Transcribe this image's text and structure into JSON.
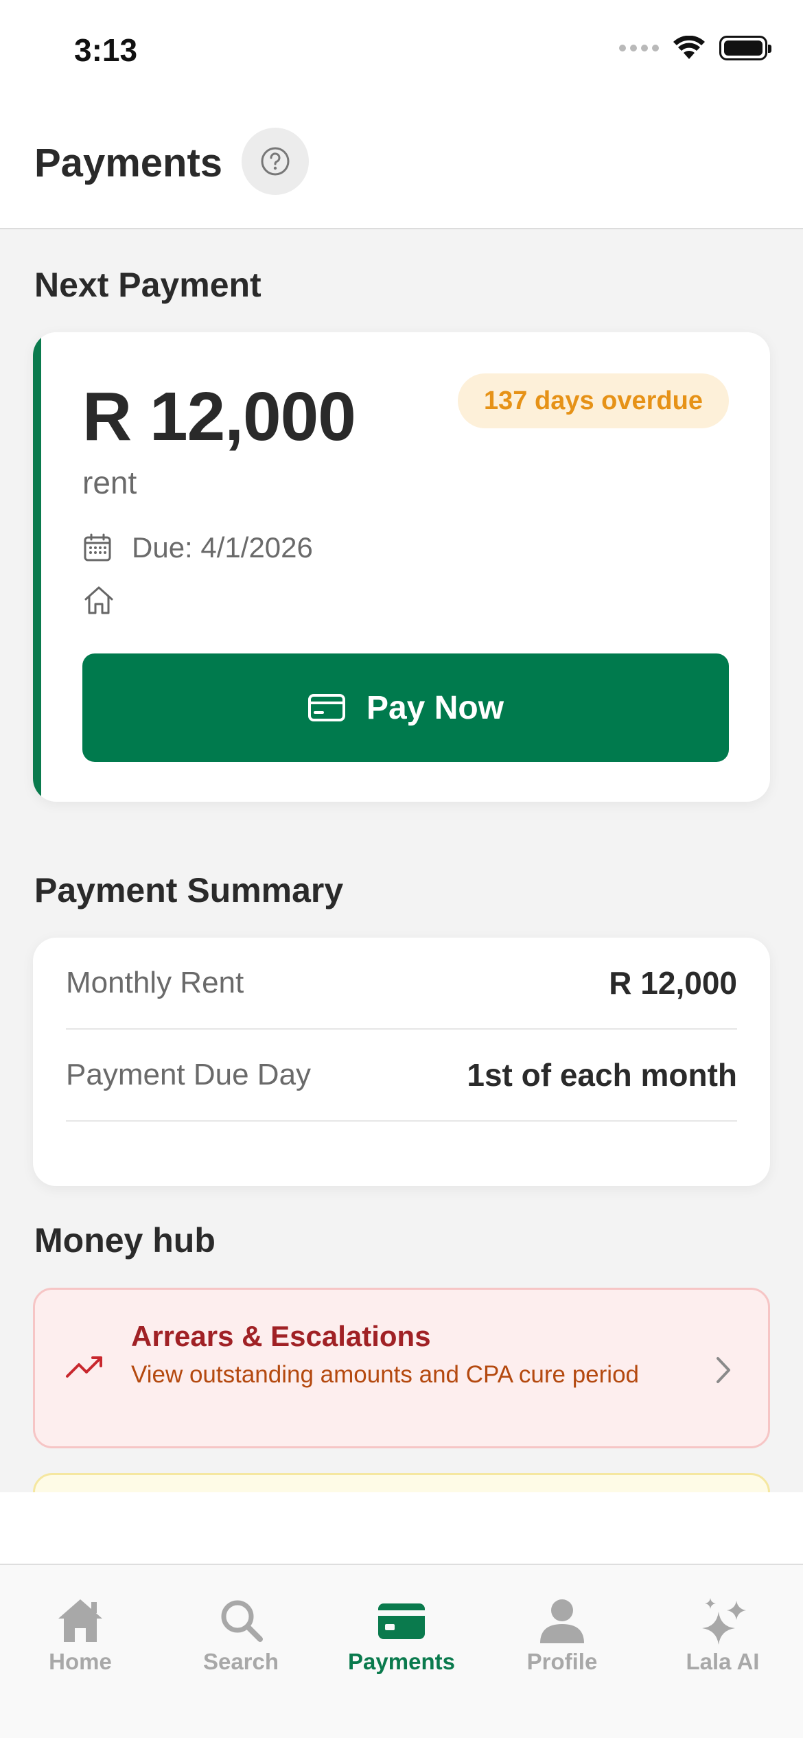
{
  "status_bar": {
    "time": "3:13"
  },
  "header": {
    "title": "Payments"
  },
  "next_payment": {
    "section_title": "Next Payment",
    "amount": "R 12,000",
    "type": "rent",
    "overdue_badge": "137 days overdue",
    "due": "Due: 4/1/2026",
    "pay_button": "Pay Now"
  },
  "summary": {
    "section_title": "Payment Summary",
    "rows": [
      {
        "label": "Monthly Rent",
        "value": "R 12,000"
      },
      {
        "label": "Payment Due Day",
        "value": "1st of each month"
      }
    ]
  },
  "money_hub": {
    "section_title": "Money hub",
    "items": [
      {
        "title": "Arrears & Escalations",
        "description": "View outstanding amounts and CPA cure period"
      }
    ]
  },
  "tabs": [
    {
      "label": "Home",
      "icon": "home-icon"
    },
    {
      "label": "Search",
      "icon": "search-icon"
    },
    {
      "label": "Payments",
      "icon": "card-icon",
      "active": true
    },
    {
      "label": "Profile",
      "icon": "person-icon"
    },
    {
      "label": "Lala AI",
      "icon": "sparkles-icon"
    }
  ],
  "colors": {
    "brand_green": "#007a4d",
    "overdue_text": "#e69217",
    "overdue_bg": "#fdf0d9",
    "arrears_title": "#a02125",
    "arrears_desc": "#b4490f",
    "arrears_bg": "#fdeeee"
  }
}
